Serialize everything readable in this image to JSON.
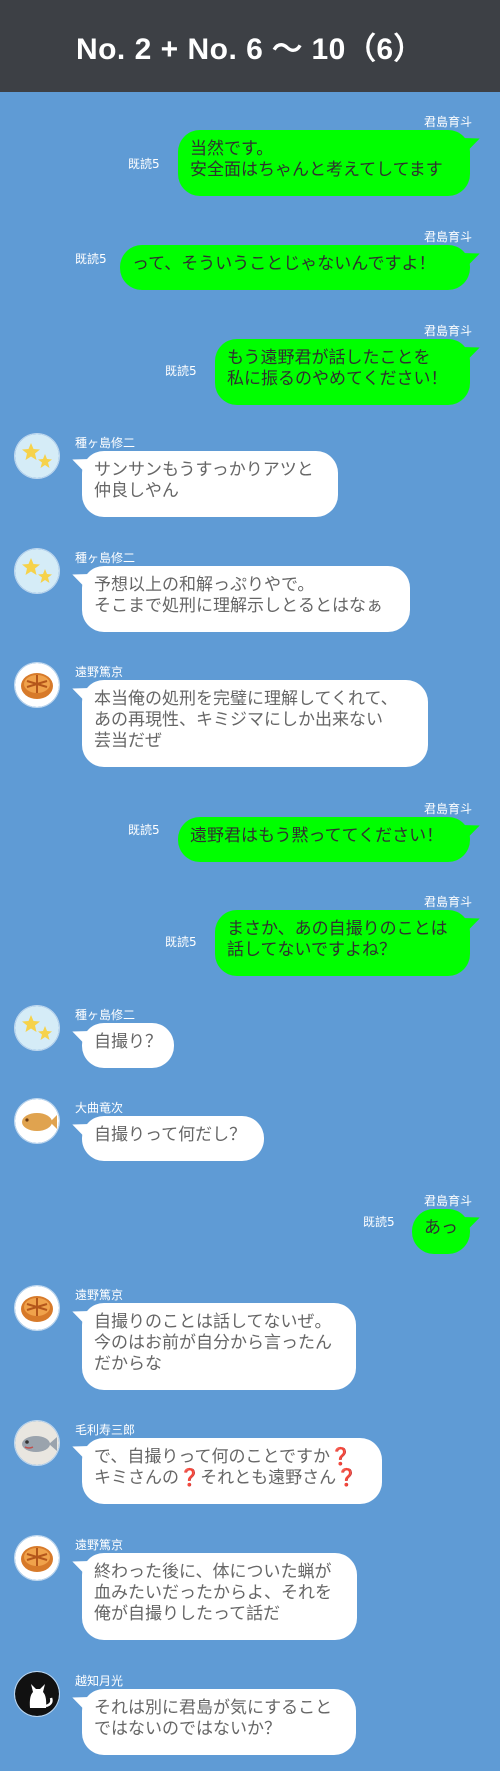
{
  "header": {
    "title": "No. 2 + No. 6 ～ 10（6）"
  },
  "read_label": "既読5",
  "messages": [
    {
      "sender": "君島育斗",
      "text": "当然です。\n安全面はちゃんと考えてしてます",
      "side": "right",
      "read": "既読5"
    },
    {
      "sender": "君島育斗",
      "text": "って、そういうことじゃないんですよ！",
      "side": "right",
      "read": "既読5"
    },
    {
      "sender": "君島育斗",
      "text": "もう遠野君が話したことを\n私に振るのやめてください！",
      "side": "right",
      "read": "既読5"
    },
    {
      "sender": "種ヶ島修二",
      "text": "サンサンもうすっかりアツと\n仲良しやん",
      "side": "left",
      "avatar": "stars-avatar-icon"
    },
    {
      "sender": "種ヶ島修二",
      "text": "予想以上の和解っぷりやで。\nそこまで処刑に理解示しとるとはなぁ",
      "side": "left",
      "avatar": "stars-avatar-icon"
    },
    {
      "sender": "遠野篤京",
      "text": "本当俺の処刑を完璧に理解してくれて、\nあの再現性、キミジマにしか出来ない\n芸当だぜ",
      "side": "left",
      "avatar": "pie-avatar-icon"
    },
    {
      "sender": "君島育斗",
      "text": "遠野君はもう黙っててください！",
      "side": "right",
      "read": "既読5"
    },
    {
      "sender": "君島育斗",
      "text": "まさか、あの自撮りのことは\n話してないですよね？",
      "side": "right",
      "read": "既読5"
    },
    {
      "sender": "種ヶ島修二",
      "text": "自撮り？",
      "side": "left",
      "avatar": "stars-avatar-icon"
    },
    {
      "sender": "大曲竜次",
      "text": "自撮りって何だし？",
      "side": "left",
      "avatar": "taiyaki-avatar-icon"
    },
    {
      "sender": "君島育斗",
      "text": "あっ",
      "side": "right",
      "read": "既読5"
    },
    {
      "sender": "遠野篤京",
      "text": "自撮りのことは話してないぜ。\n今のはお前が自分から言ったん\nだからな",
      "side": "left",
      "avatar": "pie-avatar-icon"
    },
    {
      "sender": "毛利寿三郎",
      "text_parts": [
        "で、自撮りって何のことですか",
        "❓",
        "\nキミさんの",
        "❓",
        "それとも遠野さん",
        "❓"
      ],
      "side": "left",
      "avatar": "fish-avatar-icon"
    },
    {
      "sender": "遠野篤京",
      "text": "終わった後に、体についた蝋が\n血みたいだったからよ、それを\n俺が自撮りしたって話だ",
      "side": "left",
      "avatar": "pie-avatar-icon"
    },
    {
      "sender": "越知月光",
      "text": "それは別に君島が気にすること\nではないのではないか？",
      "side": "left",
      "avatar": "cat-avatar-icon"
    }
  ],
  "colors": {
    "background": "#5f9bd5",
    "header": "#3d4045",
    "outgoing": "#00ff00",
    "incoming": "#ffffff"
  }
}
